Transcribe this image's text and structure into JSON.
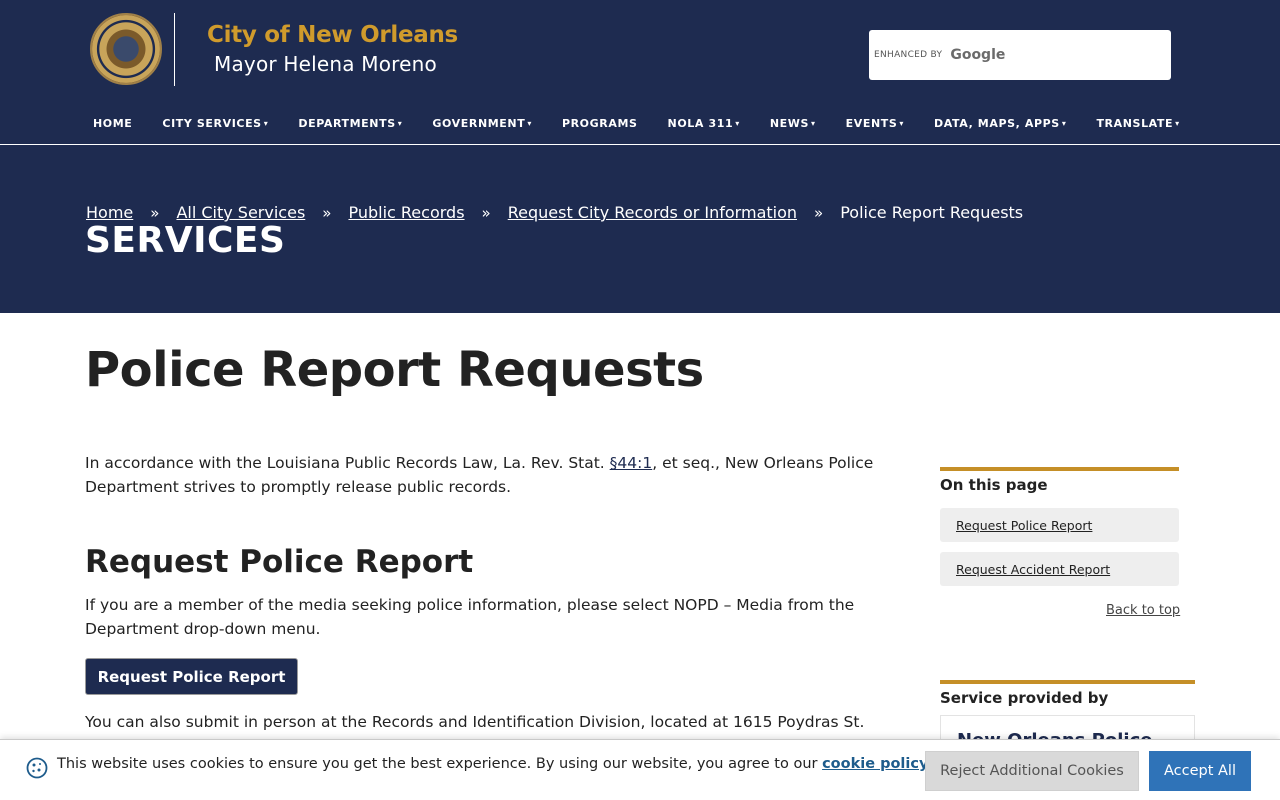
{
  "header": {
    "site_name": "City of New Orleans",
    "mayor": "Mayor Helena Moreno",
    "seal_text": "CITY OF NEW ORLEANS · LOUISIANA",
    "search": {
      "enhanced_label": "ENHANCED BY",
      "provider": "Google"
    }
  },
  "nav": {
    "items": [
      {
        "label": "HOME",
        "dropdown": false
      },
      {
        "label": "CITY SERVICES",
        "dropdown": true
      },
      {
        "label": "DEPARTMENTS",
        "dropdown": true
      },
      {
        "label": "GOVERNMENT",
        "dropdown": true
      },
      {
        "label": "PROGRAMS",
        "dropdown": false
      },
      {
        "label": "NOLA 311",
        "dropdown": true
      },
      {
        "label": "NEWS",
        "dropdown": true
      },
      {
        "label": "EVENTS",
        "dropdown": true
      },
      {
        "label": "DATA, MAPS, APPS",
        "dropdown": true
      },
      {
        "label": "TRANSLATE",
        "dropdown": true
      }
    ],
    "caret": "▾"
  },
  "breadcrumb": {
    "items": [
      "Home",
      "All City Services",
      "Public Records",
      "Request City Records or Information"
    ],
    "current": "Police Report Requests",
    "separator": "»"
  },
  "hero": {
    "section_title": "SERVICES"
  },
  "main": {
    "title": "Police Report Requests",
    "intro_before": "In accordance with the Louisiana Public Records Law, La. Rev. Stat. ",
    "intro_link": "§44:1",
    "intro_after": ", et seq., New Orleans Police Department strives to promptly release public records.",
    "section_heading": "Request Police Report",
    "section_para": "If you are a member of the media seeking police information, please select NOPD – Media from the Department drop-down menu.",
    "request_button": "Request Police Report",
    "in_person_para": "You can also submit in person at the Records and Identification Division, located at 1615 Poydras St."
  },
  "sidebar": {
    "toc_heading": "On this page",
    "toc_items": [
      "Request Police Report",
      "Request Accident Report"
    ],
    "back_to_top": "Back to top",
    "provided_heading": "Service provided by",
    "provided_by": "New Orleans Police"
  },
  "cookie": {
    "text_before": "This website uses cookies to ensure you get the best experience. By using our website, you agree to our ",
    "policy_link": "cookie policy",
    "text_after": ".",
    "reject_button": "Reject Additional Cookies",
    "accept_button": "Accept All"
  },
  "colors": {
    "navy": "#1e2b50",
    "gold": "#d09b2c",
    "accent_rule": "#c58f27",
    "accept_blue": "#2f73b8"
  }
}
